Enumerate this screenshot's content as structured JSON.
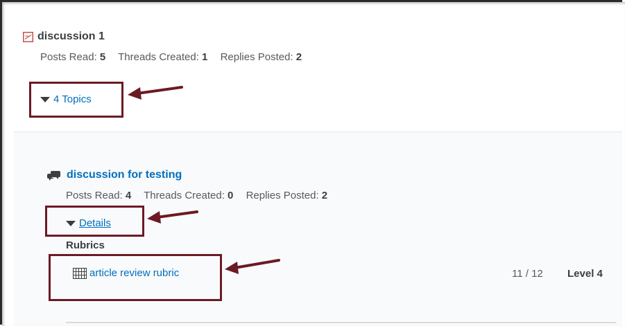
{
  "colors": {
    "link": "#006fbf",
    "highlight": "#6b1a24",
    "text": "#494c4e"
  },
  "discussion": {
    "title": "discussion 1",
    "posts_read_label": "Posts Read:",
    "posts_read": "5",
    "threads_created_label": "Threads Created:",
    "threads_created": "1",
    "replies_posted_label": "Replies Posted:",
    "replies_posted": "2",
    "topics_toggle": "4 Topics"
  },
  "topic": {
    "title": "discussion for testing",
    "posts_read_label": "Posts Read:",
    "posts_read": "4",
    "threads_created_label": "Threads Created:",
    "threads_created": "0",
    "replies_posted_label": "Replies Posted:",
    "replies_posted": "2",
    "details_toggle": "Details",
    "rubrics_label": "Rubrics",
    "rubric": {
      "name": "article review rubric",
      "score": "11 / 12",
      "level": "Level 4"
    }
  },
  "icons": {
    "discussion": "document-icon",
    "topic": "chat-bubbles-icon",
    "rubric": "grid-icon",
    "toggle": "triangle-down-icon",
    "annotation": "arrow-left-icon"
  }
}
